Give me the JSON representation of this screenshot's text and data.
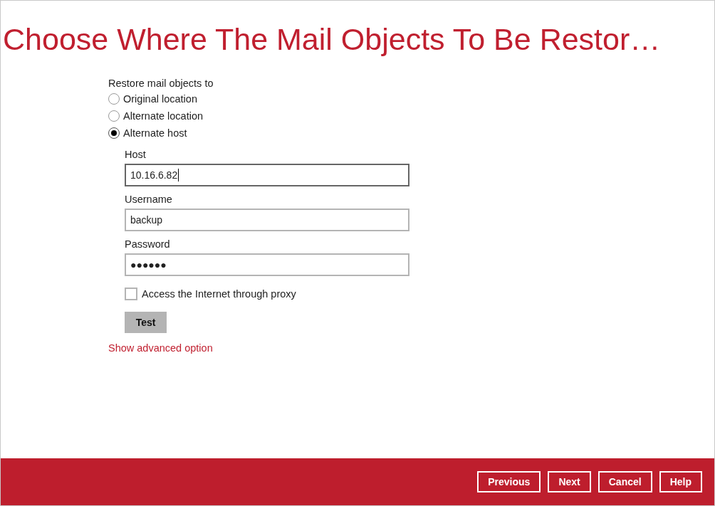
{
  "title": "Choose Where The Mail Objects To Be Restor…",
  "restore": {
    "label": "Restore mail objects to",
    "options": [
      {
        "label": "Original location",
        "selected": false
      },
      {
        "label": "Alternate location",
        "selected": false
      },
      {
        "label": "Alternate host",
        "selected": true
      }
    ]
  },
  "fields": [
    {
      "label": "Host",
      "value": "10.16.6.82",
      "focused": true
    },
    {
      "label": "Username",
      "value": "backup",
      "focused": false
    },
    {
      "label": "Password",
      "value": "●●●●●●",
      "focused": false
    }
  ],
  "proxy": {
    "label": "Access the Internet through proxy",
    "checked": false
  },
  "test_button": "Test",
  "advanced_link": "Show advanced option",
  "buttons": [
    "Previous",
    "Next",
    "Cancel",
    "Help"
  ]
}
